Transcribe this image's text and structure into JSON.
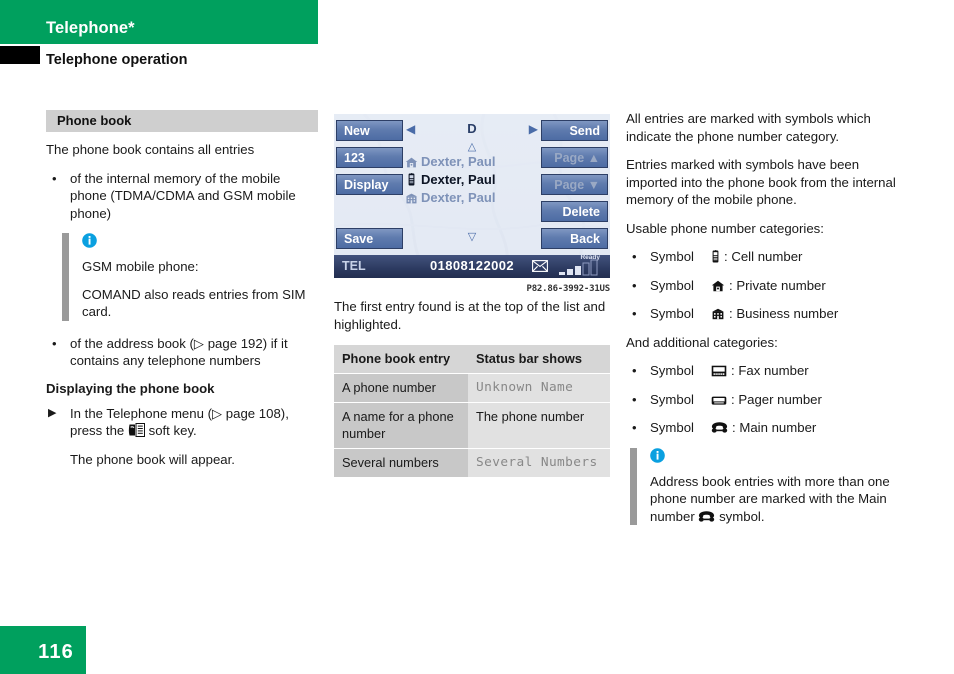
{
  "header": {
    "title": "Telephone*",
    "subtitle": "Telephone operation"
  },
  "left_column": {
    "section_title": "Phone book",
    "intro": "The phone book contains all entries",
    "bullets": [
      "of the internal memory of the mobile phone (TDMA/CDMA and GSM mobile phone)",
      "of the address book (▷ page 192) if it contains any telephone numbers"
    ],
    "note": {
      "icon": "info-icon",
      "line1": "GSM mobile phone:",
      "line2": "COMAND also reads entries from SIM card."
    },
    "subheading": "Displaying the phone book",
    "step_pre": "In the Telephone menu (▷ page 108), press the",
    "step_post": "soft key.",
    "step_icon": "phonebook-softkey-icon",
    "step_result": "The phone book will appear."
  },
  "device": {
    "left_buttons": [
      {
        "label": "New",
        "disabled": false
      },
      {
        "label": "123",
        "disabled": false
      },
      {
        "label": "Display",
        "disabled": false
      },
      {
        "label": "Save",
        "disabled": false
      }
    ],
    "right_buttons": [
      {
        "label": "Send",
        "disabled": false
      },
      {
        "label": "Page ▲",
        "disabled": true
      },
      {
        "label": "Page ▼",
        "disabled": true
      },
      {
        "label": "Delete",
        "disabled": false
      },
      {
        "label": "Back",
        "disabled": false
      }
    ],
    "nav_letter": "D",
    "nav_left_arrow": "◀",
    "nav_right_arrow": "▶",
    "scroll_up": "△",
    "scroll_down": "▽",
    "entries": [
      {
        "icon": "home-icon",
        "name": "Dexter, Paul",
        "selected": false
      },
      {
        "icon": "cellphone-icon",
        "name": "Dexter, Paul",
        "selected": true
      },
      {
        "icon": "office-icon",
        "name": "Dexter, Paul",
        "selected": false
      }
    ],
    "status_bar": {
      "mode": "TEL",
      "number": "01808122002",
      "message_icon": "envelope-icon",
      "signal_label": "Ready",
      "signal_icon": "signal-bars-icon"
    },
    "figure_caption": "P82.86-3992-31US"
  },
  "mid_column": {
    "caption_text": "The first entry found is at the top of the list and highlighted.",
    "table": {
      "headers": [
        "Phone book entry",
        "Status bar shows"
      ],
      "rows": [
        {
          "entry": "A phone number",
          "status": "Unknown Name",
          "mono": true
        },
        {
          "entry": "A name for a phone number",
          "status": "The phone number",
          "mono": false
        },
        {
          "entry": "Several numbers",
          "status": "Several Numbers",
          "mono": true
        }
      ]
    }
  },
  "right_column": {
    "para1": "All entries are marked with symbols which indicate the phone number category.",
    "para2": "Entries marked with symbols have been imported into the phone book from the internal memory of the mobile phone.",
    "para3": "Usable phone number categories:",
    "symbols_primary": [
      {
        "prefix": "Symbol",
        "icon": "cellphone-icon",
        "label": ": Cell number"
      },
      {
        "prefix": "Symbol",
        "icon": "home-icon",
        "label": ": Private number"
      },
      {
        "prefix": "Symbol",
        "icon": "office-icon",
        "label": ": Business number"
      }
    ],
    "para4": "And additional categories:",
    "symbols_additional": [
      {
        "prefix": "Symbol",
        "icon": "fax-icon",
        "label": ": Fax number"
      },
      {
        "prefix": "Symbol",
        "icon": "pager-icon",
        "label": ": Pager number"
      },
      {
        "prefix": "Symbol",
        "icon": "main-phone-icon",
        "label": ": Main number"
      }
    ],
    "note": {
      "icon": "info-icon",
      "text_pre": "Address book entries with more than one phone number are marked with the Main number",
      "text_post": "symbol."
    }
  },
  "footer": {
    "page_number": "116"
  },
  "colors": {
    "brand_green": "#00a05e",
    "section_bar": "#cfcfcf",
    "note_bar": "#9a9a9a",
    "info_blue": "#0aa0e0",
    "device_button": "#5f7bae",
    "status_bar": "#2c3a60"
  }
}
